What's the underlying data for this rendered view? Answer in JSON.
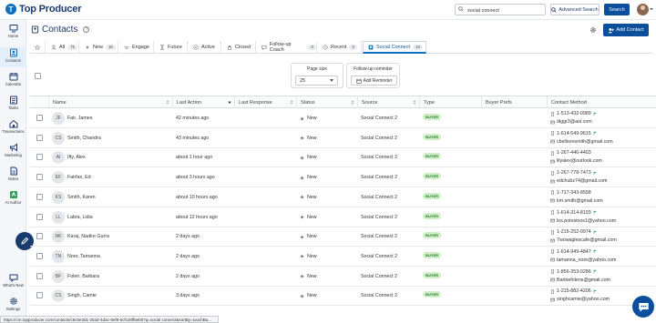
{
  "topbar": {
    "logo_text": "Top Producer",
    "search_value": "social connect",
    "advanced_search": "Advanced Search",
    "search_button": "Search"
  },
  "sidebar": {
    "items": [
      {
        "label": "Home",
        "icon": "monitor-icon"
      },
      {
        "label": "Contacts",
        "icon": "contacts-icon"
      },
      {
        "label": "Calendar",
        "icon": "calendar-icon"
      },
      {
        "label": "Tasks",
        "icon": "tasks-icon"
      },
      {
        "label": "Transactions",
        "icon": "transactions-icon"
      },
      {
        "label": "Marketing",
        "icon": "megaphone-icon"
      },
      {
        "label": "Notes",
        "icon": "notes-icon"
      },
      {
        "label": "AI Author",
        "icon": "ai-author-icon"
      },
      {
        "label": "What's New",
        "icon": "whats-new-icon"
      },
      {
        "label": "Settings",
        "icon": "gear-icon"
      }
    ]
  },
  "header": {
    "title": "Contacts",
    "add_contact": "Add Contact"
  },
  "tabs": [
    {
      "label": "All",
      "count": "7k"
    },
    {
      "label": "New",
      "count": "1k"
    },
    {
      "label": "Engage",
      "count": ""
    },
    {
      "label": "Future",
      "count": ""
    },
    {
      "label": "Active",
      "count": ""
    },
    {
      "label": "Closed",
      "count": ""
    },
    {
      "label": "Follow-up Coach",
      "count": "0"
    },
    {
      "label": "Recent",
      "count": "0"
    },
    {
      "label": "Social Connect",
      "count": "16"
    }
  ],
  "filters": {
    "page_size_label": "Page size",
    "page_size_value": "25",
    "followup_label": "Follow-up reminder",
    "add_reminder": "Add Reminder"
  },
  "columns": [
    "Name",
    "Last Action",
    "Last Response",
    "Status",
    "Source",
    "Type",
    "Buyer Prefs",
    "Contact Method"
  ],
  "rows": [
    {
      "initials": "JF",
      "name": "Fair, James",
      "last_action": "42 minutes ago",
      "status": "New",
      "source": "Social Connect 2",
      "type": "BUYER",
      "phone": "1-513-432-0989",
      "email": "diggr3@aol.com"
    },
    {
      "initials": "CS",
      "name": "Smith, Chandra",
      "last_action": "43 minutes ago",
      "status": "New",
      "source": "Social Connect 2",
      "type": "BUYER",
      "phone": "1-614-549-9615",
      "email": "cbellsonsmith@gmail.com"
    },
    {
      "initials": "AI",
      "name": "Ifty, Alex",
      "last_action": "about 1 hour ago",
      "status": "New",
      "source": "Social Connect 2",
      "type": "BUYER",
      "phone": "1-267-446-4403",
      "email": "lilyalex@outlook.com"
    },
    {
      "initials": "EF",
      "name": "Fairfax, Ed",
      "last_action": "about 3 hours ago",
      "status": "New",
      "source": "Social Connect 2",
      "type": "BUYER",
      "phone": "1-267-778-7473",
      "email": "edchubz74@gmail.com"
    },
    {
      "initials": "KS",
      "name": "Smith, Karen",
      "last_action": "about 10 hours ago",
      "status": "New",
      "source": "Social Connect 2",
      "type": "BUYER",
      "phone": "1-717-343-8598",
      "email": "km.smith@gmail.com"
    },
    {
      "initials": "LL",
      "name": "Labra, Lidia",
      "last_action": "about 12 hours ago",
      "status": "New",
      "source": "Social Connect 2",
      "type": "BUYER",
      "phone": "1-614-314-8193",
      "email": "los.potosinos1@yahoo.com"
    },
    {
      "initials": "NK",
      "name": "Karaj, Nadire Gurra",
      "last_action": "2 days ago",
      "status": "New",
      "source": "Social Connect 2",
      "type": "BUYER",
      "phone": "1-215-252-0974",
      "email": "7wowaglescafe@gmail.com"
    },
    {
      "initials": "TN",
      "name": "Noor, Tamanna",
      "last_action": "2 days ago",
      "status": "New",
      "source": "Social Connect 2",
      "type": "BUYER",
      "phone": "1-614-949-4847",
      "email": "tamanna_noor@yahoo.com"
    },
    {
      "initials": "BF",
      "name": "Folen, Barbara",
      "last_action": "2 days ago",
      "status": "New",
      "source": "Social Connect 2",
      "type": "BUYER",
      "phone": "1-856-353-0286",
      "email": "Barbiefolens@gmail.com"
    },
    {
      "initials": "CS",
      "name": "Singh, Camie",
      "last_action": "3 days ago",
      "status": "New",
      "source": "Social Connect 2",
      "type": "BUYER",
      "phone": "1-215-882-4206",
      "email": "singhcamie@yahoo.com"
    }
  ],
  "statusbar_url": "https://cm.topproducer.com/contacts/c8c5e3d1-253d-4dac-8ef8-6cfc28ff6eb0?q=social connect&sortBy=touchBa..."
}
